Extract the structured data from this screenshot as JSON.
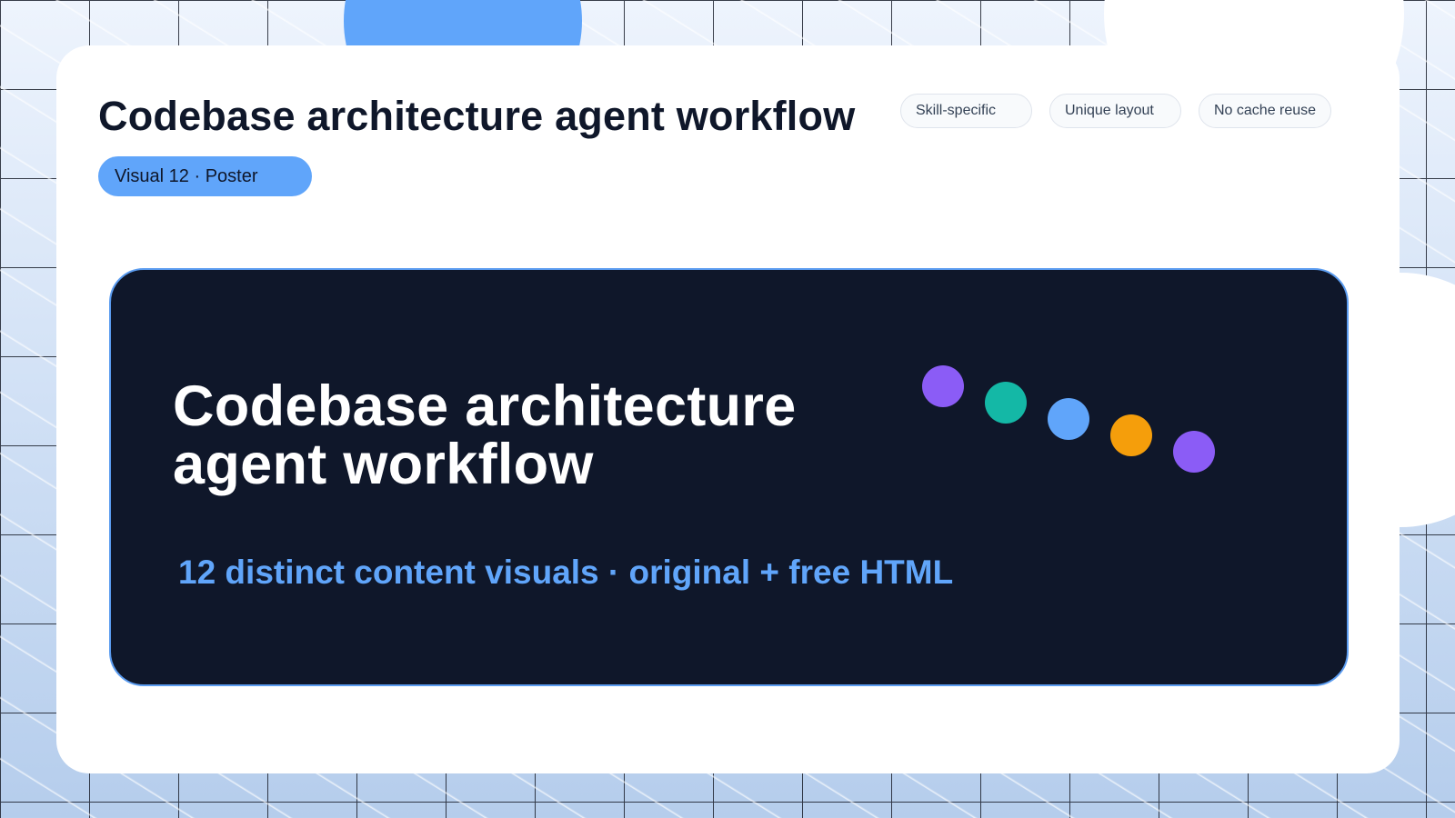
{
  "header": {
    "title": "Codebase architecture agent workflow",
    "badge": "Visual 12 · Poster"
  },
  "tags": [
    "Skill-specific",
    "Unique layout",
    "No cache reuse"
  ],
  "poster": {
    "title": "Codebase architecture agent workflow",
    "subtitle": "12 distinct content visuals · original + free HTML"
  },
  "colors": {
    "accent": "#60a5fa",
    "poster_bg": "#0f172a",
    "dots": [
      "#8b5cf6",
      "#14b8a6",
      "#60a5fa",
      "#f59e0b",
      "#8b5cf6"
    ]
  }
}
